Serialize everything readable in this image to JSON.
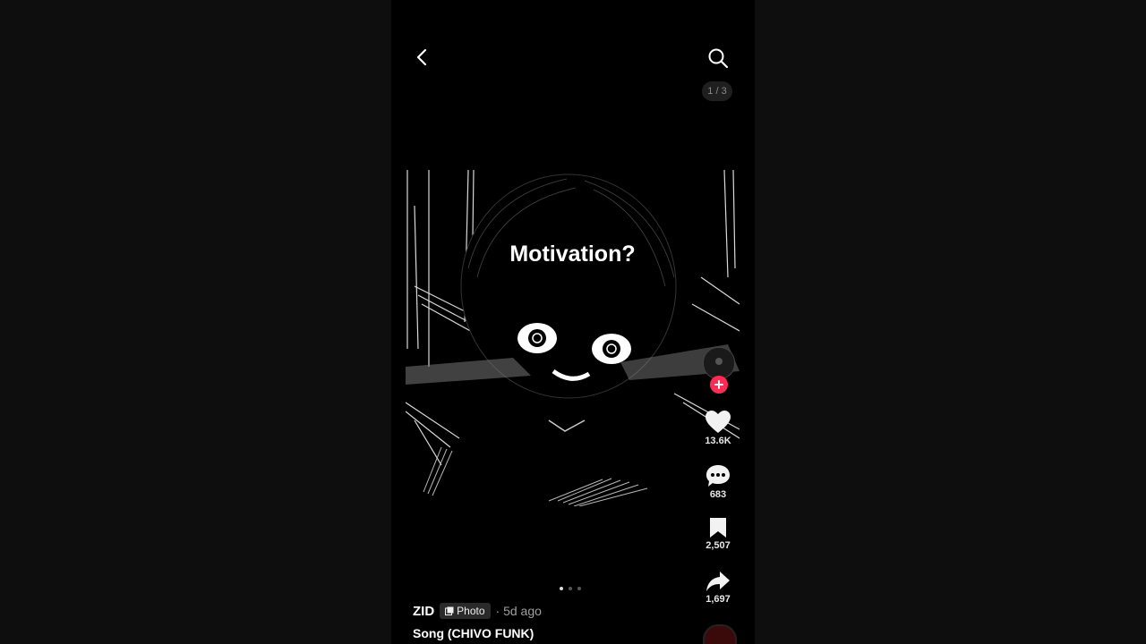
{
  "header": {
    "counter": "1 / 3"
  },
  "post": {
    "caption": "Motivation?",
    "slide_index": 1,
    "slide_total": 3
  },
  "actions": {
    "likes": "13.6K",
    "comments": "683",
    "saves": "2,507",
    "shares": "1,697"
  },
  "author": {
    "username": "ZID",
    "badge": "Photo",
    "time_ago": "· 5d ago"
  },
  "music": {
    "song": "Song (CHIVO FUNK)"
  },
  "colors": {
    "follow": "#fe2c55",
    "background": "#000000"
  },
  "icons": [
    "back-icon",
    "search-icon",
    "plus-icon",
    "heart-icon",
    "comment-icon",
    "bookmark-icon",
    "share-icon",
    "photo-icon"
  ]
}
